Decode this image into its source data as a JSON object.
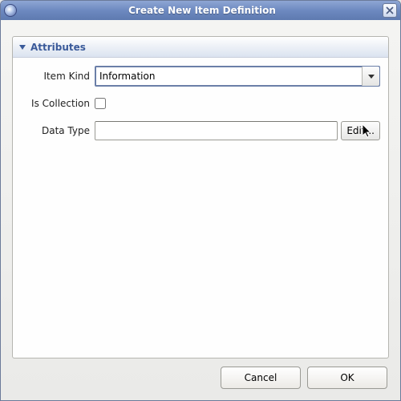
{
  "window": {
    "title": "Create New Item Definition"
  },
  "panel": {
    "title": "Attributes"
  },
  "form": {
    "item_kind": {
      "label": "Item Kind",
      "value": "Information"
    },
    "is_collection": {
      "label": "Is Collection",
      "checked": false
    },
    "data_type": {
      "label": "Data Type",
      "value": "",
      "edit_button": "Edit..."
    }
  },
  "buttons": {
    "cancel": "Cancel",
    "ok": "OK"
  }
}
